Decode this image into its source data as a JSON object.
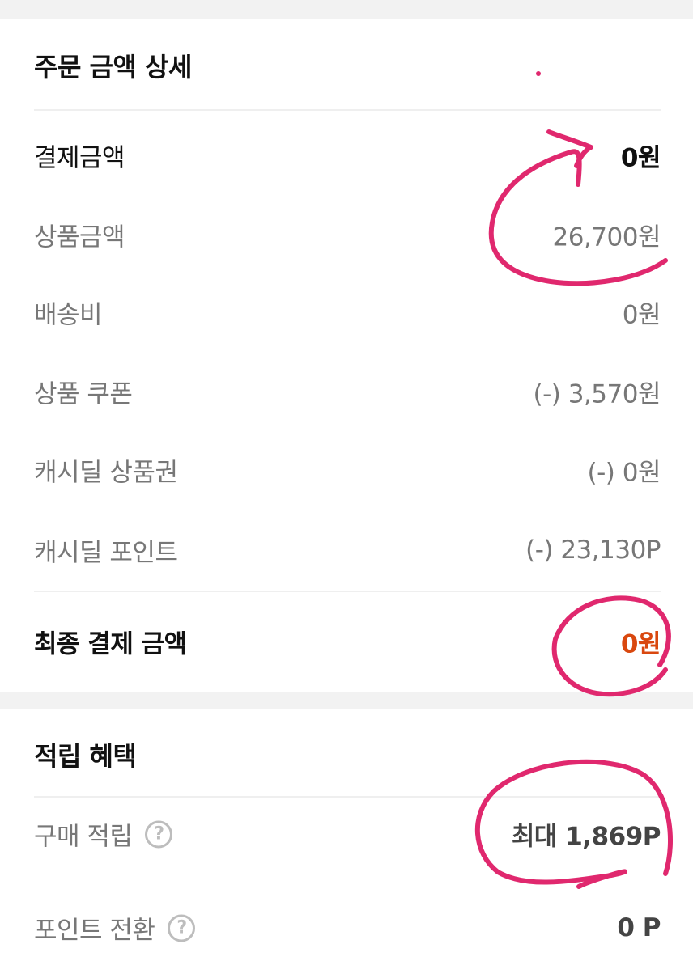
{
  "order_detail": {
    "title": "주문 금액 상세",
    "rows": [
      {
        "label": "결제금액",
        "value": "0원"
      },
      {
        "label": "상품금액",
        "value": "26,700원"
      },
      {
        "label": "배송비",
        "value": "0원"
      },
      {
        "label": "상품 쿠폰",
        "value": "(-) 3,570원"
      },
      {
        "label": "캐시딜 상품권",
        "value": "(-) 0원"
      },
      {
        "label": "캐시딜 포인트",
        "value": "(-) 23,130P"
      }
    ],
    "final": {
      "label": "최종 결제 금액",
      "value": "0원"
    }
  },
  "benefits": {
    "title": "적립 혜택",
    "rows": [
      {
        "label": "구매 적립",
        "value": "최대 1,869P"
      },
      {
        "label": "포인트 전환",
        "value": "0 P"
      }
    ],
    "help_icon": "question-circle-icon",
    "help_glyph": "?"
  },
  "colors": {
    "final_amount": "#d9480f",
    "annotation": "#e0286e",
    "divider": "#efefef"
  }
}
